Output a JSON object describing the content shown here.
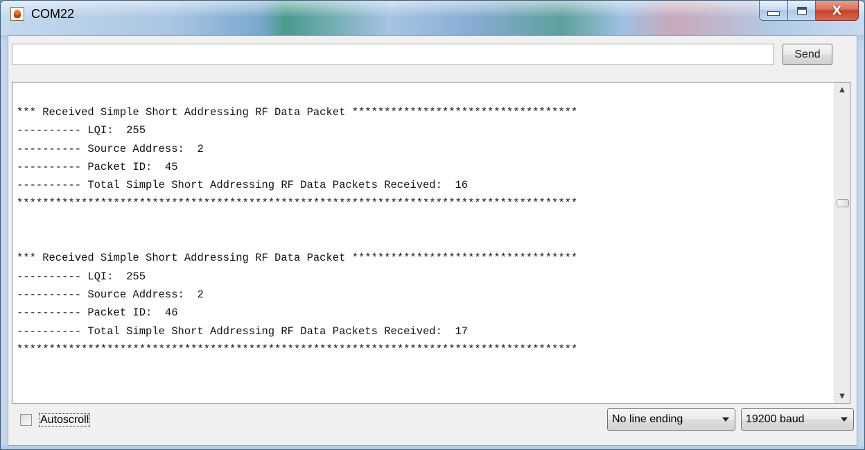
{
  "window": {
    "title": "COM22",
    "icon": "arduino-java-icon",
    "controls": {
      "minimize": "minimize-icon",
      "maximize": "maximize-icon",
      "close_glyph": "X"
    }
  },
  "input_bar": {
    "value": "",
    "placeholder": "",
    "send_label": "Send"
  },
  "output": {
    "lines": [
      "*** Received Simple Short Addressing RF Data Packet ***********************************",
      "---------- LQI:  255",
      "---------- Source Address:  2",
      "---------- Packet ID:  45",
      "---------- Total Simple Short Addressing RF Data Packets Received:  16",
      "***************************************************************************************",
      "",
      "",
      "*** Received Simple Short Addressing RF Data Packet ***********************************",
      "---------- LQI:  255",
      "---------- Source Address:  2",
      "---------- Packet ID:  46",
      "---------- Total Simple Short Addressing RF Data Packets Received:  17",
      "***************************************************************************************"
    ],
    "scroll_position": 0.36
  },
  "footer": {
    "autoscroll_label": "Autoscroll",
    "autoscroll_checked": false,
    "line_ending": "No line ending",
    "baud_rate": "19200 baud"
  }
}
